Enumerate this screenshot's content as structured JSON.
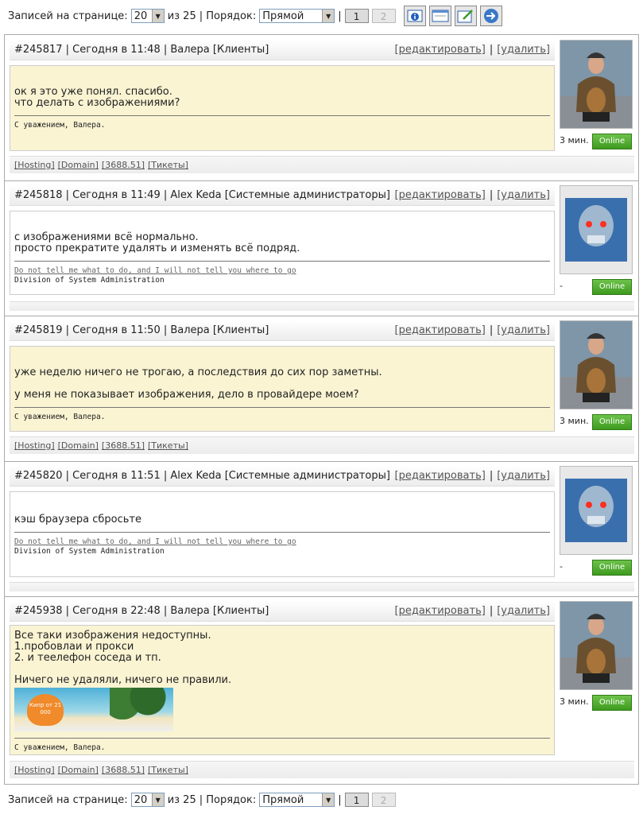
{
  "pager": {
    "per_page_label": "Записей на странице:",
    "per_page_value": "20",
    "of_total": "из 25",
    "order_label": "| Порядок:",
    "order_value": "Прямой",
    "sep": "|",
    "page1": "1",
    "page2": "2"
  },
  "toolbar_icons": [
    "info-icon",
    "window-icon",
    "edit-icon",
    "forward-icon"
  ],
  "posts": [
    {
      "header": "#245817 | Сегодня в 11:48 | Валера [Клиенты]",
      "edit": "[редактировать]",
      "sep": "|",
      "delete": "[удалить]",
      "lines": [
        "ок я это уже понял. спасибо.",
        "что делать с изображениями?"
      ],
      "sig1": "С уважением, Валера.",
      "ago": "3 мин.",
      "status": "Online",
      "links": [
        "[Hosting]",
        "[Domain]",
        "[3688.51]",
        "[Тикеты]"
      ]
    },
    {
      "header": "#245818 | Сегодня в 11:49 | Alex Keda [Системные администраторы]",
      "edit": "[редактировать]",
      "sep": "|",
      "delete": "[удалить]",
      "lines": [
        "с изображениями всё нормально.",
        "просто прекратите удалять и изменять всё подряд."
      ],
      "sig_link": "Do not tell me what to do, and I will not tell you where to go",
      "sig2": "Division of System Administration",
      "ago": "-",
      "status": "Online"
    },
    {
      "header": "#245819 | Сегодня в 11:50 | Валера [Клиенты]",
      "edit": "[редактировать]",
      "sep": "|",
      "delete": "[удалить]",
      "lines": [
        "уже неделю ничего не трогаю, а последствия до сих пор заметны.",
        "",
        "у меня не показывает изображения, дело в провайдере моем?"
      ],
      "sig1": "С уважением, Валера.",
      "ago": "3 мин.",
      "status": "Online",
      "links": [
        "[Hosting]",
        "[Domain]",
        "[3688.51]",
        "[Тикеты]"
      ]
    },
    {
      "header": "#245820 | Сегодня в 11:51 | Alex Keda [Системные администраторы]",
      "edit": "[редактировать]",
      "sep": "|",
      "delete": "[удалить]",
      "lines": [
        "кэш браузера сбросьте"
      ],
      "sig_link": "Do not tell me what to do, and I will not tell you where to go",
      "sig2": "Division of System Administration",
      "ago": "-",
      "status": "Online"
    },
    {
      "header": "#245938 | Сегодня в 22:48 | Валера [Клиенты]",
      "edit": "[редактировать]",
      "sep": "|",
      "delete": "[удалить]",
      "lines": [
        "Все таки изображения недоступны.",
        "1.пробовлаи и прокси",
        "2. и теелефон соседа и тп.",
        "",
        "Ничего не удаляли, ничего не правили."
      ],
      "banner_text": "Кипр от 21 000",
      "sig1": "С уважением, Валера.",
      "ago": "3 мин.",
      "status": "Online",
      "links": [
        "[Hosting]",
        "[Domain]",
        "[3688.51]",
        "[Тикеты]"
      ]
    }
  ],
  "colors": {
    "client_bg": "#faf4d3",
    "online": "#4caf26"
  }
}
